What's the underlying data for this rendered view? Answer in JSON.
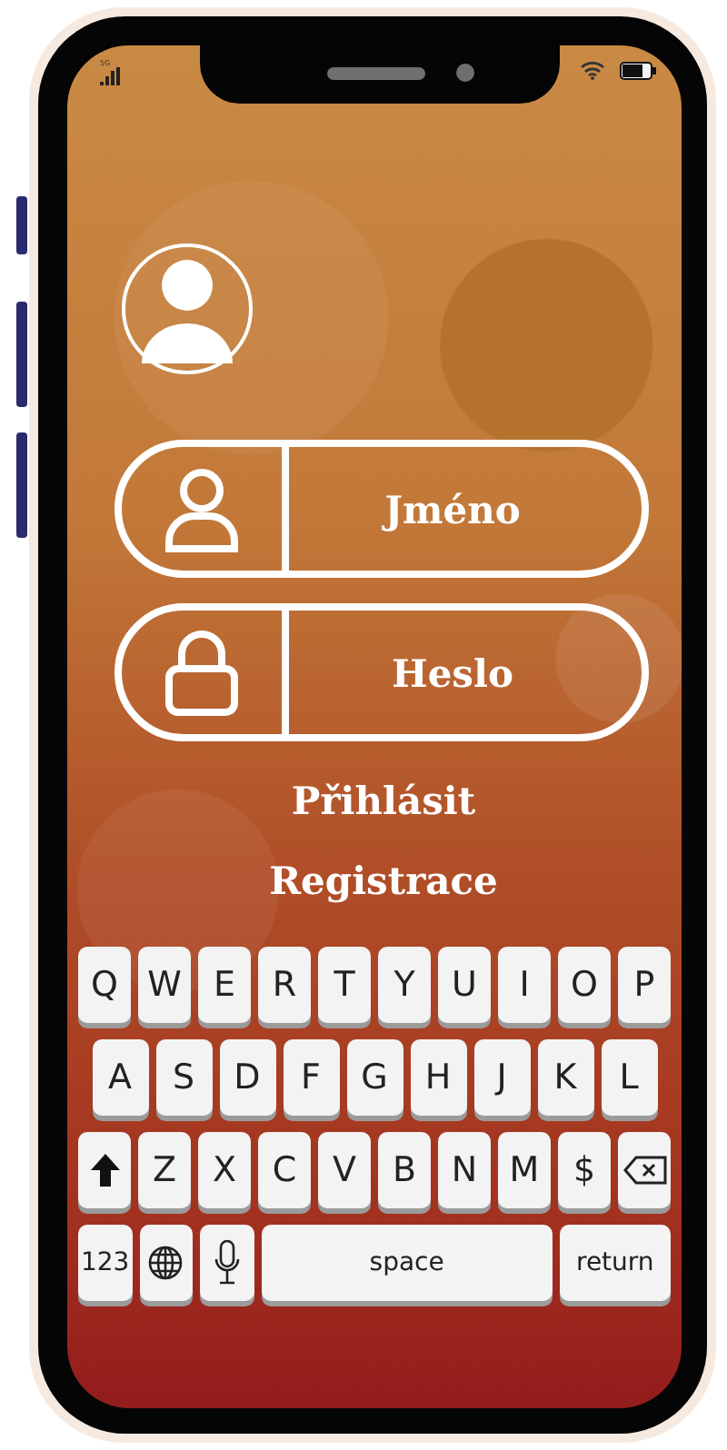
{
  "status_bar": {
    "network": "5G"
  },
  "fields": [
    {
      "kind": "user",
      "placeholder": "Jméno"
    },
    {
      "kind": "lock",
      "placeholder": "Heslo"
    }
  ],
  "login_button": "Přihlásit",
  "register_button": "Registrace",
  "keyboard": {
    "rows": [
      {
        "keys": [
          {
            "kind": "char",
            "label": "Q"
          },
          {
            "kind": "char",
            "label": "W"
          },
          {
            "kind": "char",
            "label": "E"
          },
          {
            "kind": "char",
            "label": "R"
          },
          {
            "kind": "char",
            "label": "T"
          },
          {
            "kind": "char",
            "label": "Y"
          },
          {
            "kind": "char",
            "label": "U"
          },
          {
            "kind": "char",
            "label": "I"
          },
          {
            "kind": "char",
            "label": "O"
          },
          {
            "kind": "char",
            "label": "P"
          }
        ]
      },
      {
        "keys": [
          {
            "kind": "char",
            "label": "A"
          },
          {
            "kind": "char",
            "label": "S"
          },
          {
            "kind": "char",
            "label": "D"
          },
          {
            "kind": "char",
            "label": "F"
          },
          {
            "kind": "char",
            "label": "G"
          },
          {
            "kind": "char",
            "label": "H"
          },
          {
            "kind": "char",
            "label": "J"
          },
          {
            "kind": "char",
            "label": "K"
          },
          {
            "kind": "char",
            "label": "L"
          }
        ]
      },
      {
        "keys": [
          {
            "kind": "shift"
          },
          {
            "kind": "char",
            "label": "Z"
          },
          {
            "kind": "char",
            "label": "X"
          },
          {
            "kind": "char",
            "label": "C"
          },
          {
            "kind": "char",
            "label": "V"
          },
          {
            "kind": "char",
            "label": "B"
          },
          {
            "kind": "char",
            "label": "N"
          },
          {
            "kind": "char",
            "label": "M"
          },
          {
            "kind": "char",
            "label": "$"
          },
          {
            "kind": "backspace"
          }
        ]
      },
      {
        "keys": [
          {
            "kind": "char",
            "label": "123"
          },
          {
            "kind": "globe"
          },
          {
            "kind": "mic"
          },
          {
            "kind": "space",
            "label": "space"
          },
          {
            "kind": "return",
            "label": "return"
          }
        ]
      }
    ]
  }
}
